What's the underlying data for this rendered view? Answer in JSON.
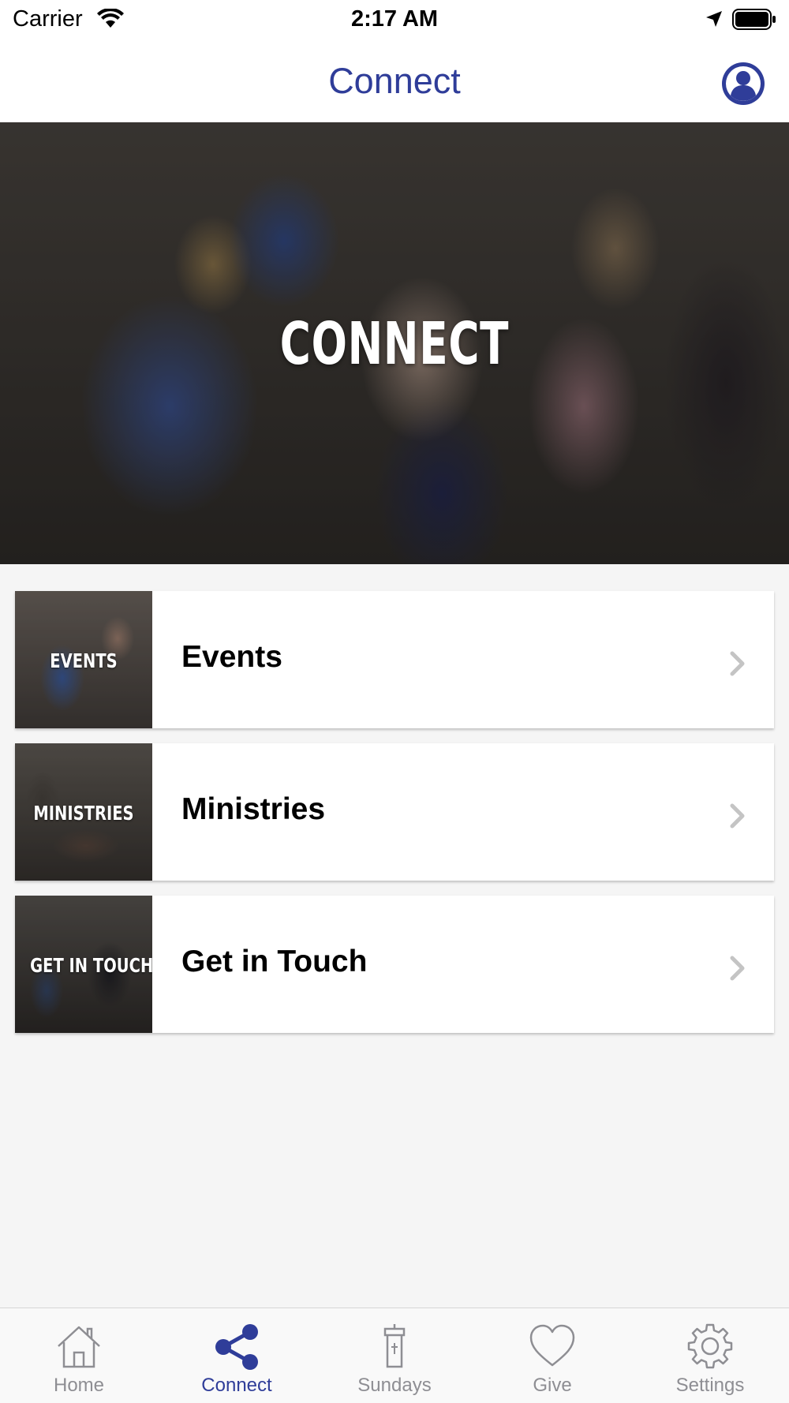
{
  "status_bar": {
    "carrier": "Carrier",
    "time": "2:17 AM"
  },
  "nav": {
    "title": "Connect",
    "profile_icon": "person-circle-icon"
  },
  "hero": {
    "title": "CONNECT"
  },
  "items": [
    {
      "thumb_label": "EVENTS",
      "label": "Events",
      "icon": "chevron-right-icon"
    },
    {
      "thumb_label": "MINISTRIES",
      "label": "Ministries",
      "icon": "chevron-right-icon"
    },
    {
      "thumb_label": "GET IN TOUCH",
      "label": "Get in Touch",
      "icon": "chevron-right-icon"
    }
  ],
  "tabs": [
    {
      "label": "Home",
      "icon": "house-icon",
      "active": false
    },
    {
      "label": "Connect",
      "icon": "share-icon",
      "active": true
    },
    {
      "label": "Sundays",
      "icon": "pulpit-icon",
      "active": false
    },
    {
      "label": "Give",
      "icon": "heart-icon",
      "active": false
    },
    {
      "label": "Settings",
      "icon": "gear-icon",
      "active": false
    }
  ],
  "colors": {
    "accent": "#2f3d99",
    "tab_inactive": "#8e8e93",
    "background": "#f5f5f5"
  }
}
